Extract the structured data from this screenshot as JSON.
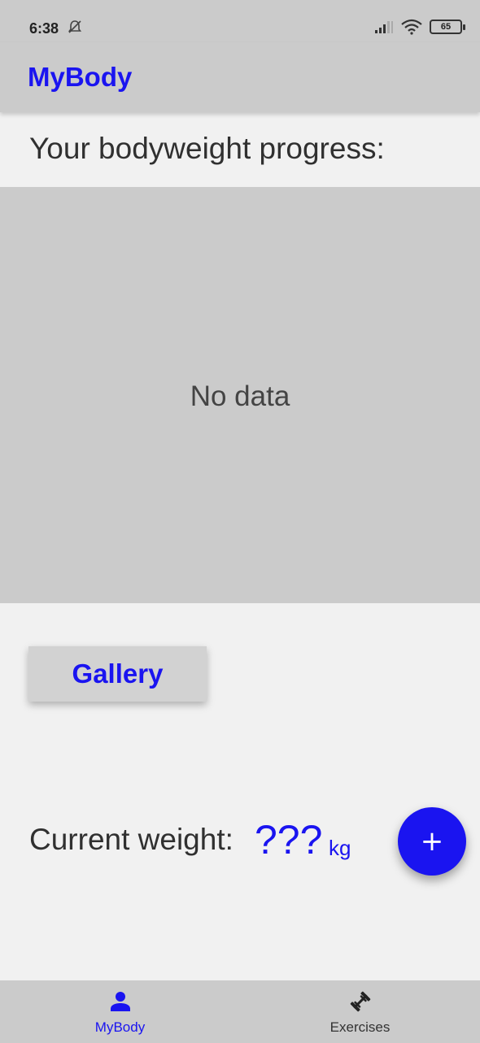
{
  "status_bar": {
    "time": "6:38",
    "battery": "65",
    "icons": [
      "alarm-off-icon",
      "signal-icon",
      "wifi-icon",
      "battery-icon"
    ]
  },
  "app_bar": {
    "title": "MyBody"
  },
  "main": {
    "heading": "Your bodyweight progress:",
    "chart_empty_text": "No data",
    "gallery_label": "Gallery",
    "current_weight_label": "Current weight:",
    "current_weight_value": "???",
    "current_weight_unit": "kg",
    "fab_label": "+"
  },
  "bottom_nav": {
    "items": [
      {
        "label": "MyBody",
        "icon": "person-icon",
        "active": true
      },
      {
        "label": "Exercises",
        "icon": "dumbbell-icon",
        "active": false
      }
    ]
  },
  "colors": {
    "accent": "#1a14f0",
    "bar_background": "#cbcbcb",
    "page_background": "#f1f1f1"
  }
}
